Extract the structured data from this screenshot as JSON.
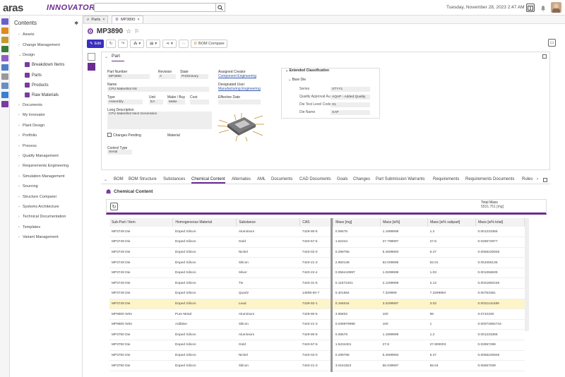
{
  "app": {
    "logo": "aras",
    "logo_suffix": "INNOVATOR",
    "date": "Tuesday, November 28, 2023 2:47 AM",
    "colors": {
      "accent": "#6b2c91",
      "primary": "#3a2ec0",
      "highlight": "#fdf5c8"
    }
  },
  "sidebar": {
    "title": "Contents",
    "items": [
      {
        "label": "Assets"
      },
      {
        "label": "Change Management"
      },
      {
        "label": "Design"
      }
    ],
    "design_children": [
      {
        "label": "Breakdown Items"
      },
      {
        "label": "Parts"
      },
      {
        "label": "Products"
      },
      {
        "label": "Raw Materials"
      }
    ],
    "more_items": [
      {
        "label": "Documents"
      },
      {
        "label": "My Innovator"
      },
      {
        "label": "Plant Design"
      },
      {
        "label": "Portfolio"
      },
      {
        "label": "Process"
      },
      {
        "label": "Quality Management"
      },
      {
        "label": "Requirements Engineering"
      },
      {
        "label": "Simulation Management"
      },
      {
        "label": "Sourcing"
      },
      {
        "label": "Structure Comparer"
      },
      {
        "label": "Systems Architecture"
      },
      {
        "label": "Technical Documentation"
      },
      {
        "label": "Templates"
      },
      {
        "label": "Variant Management"
      }
    ]
  },
  "tabs": [
    {
      "label": "Parts"
    },
    {
      "label": "MP3890"
    }
  ],
  "item": {
    "title": "MP3890"
  },
  "toolbar": {
    "edit": "Edit",
    "bom_compare": "BOM Compare"
  },
  "form": {
    "tab": "Part",
    "part_number_label": "Part Number",
    "part_number": "MP3890",
    "revision_label": "Revision",
    "revision": "A",
    "state_label": "State",
    "state": "Preliminary",
    "name_label": "Name",
    "name": "CPU MakerBot NX",
    "type_label": "Type",
    "type": "Assembly",
    "unit_label": "Unit",
    "unit": "EA",
    "make_buy_label": "Make / Buy",
    "make_buy": "Make",
    "cost_label": "Cost",
    "long_desc_label": "Long Description",
    "long_desc": "CPU MakerBot Next Generation",
    "changes_pending": "Changes Pending",
    "material_label": "Material",
    "control_type_label": "Control Type",
    "control_type": "Serial",
    "assigned_creator_label": "Assigned Creator",
    "assigned_creator": "Component Engineering",
    "designated_user_label": "Designated User",
    "designated_user": "Manufacturing Engineering",
    "effective_date_label": "Effective Date",
    "ext_class_title": "Extended Classification",
    "bare_die": "Bare Die",
    "series_label": "Series",
    "series": "XTYY1",
    "qa_label": "Quality Approval Au...",
    "qa": "AQAP - Added Quality",
    "die_test_label": "Die Test Level Code",
    "die_test": "X1",
    "die_name_label": "Die Name",
    "die_name": "XAP"
  },
  "reltabs": [
    "BOM",
    "BOM Structure",
    "Substances",
    "Chemical Content",
    "Alternates",
    "AML",
    "Documents",
    "CAD Documents",
    "Goals",
    "Changes",
    "Part Submission Warrants",
    "Requirements",
    "Requirements Documents",
    "Rules"
  ],
  "chem": {
    "title": "Chemical Content",
    "total_label": "Total Mass",
    "total": "5531.751 [mg]"
  },
  "table": {
    "headers": [
      "Sub-Part / Item",
      "Homogeneous Material",
      "Substance",
      "CAS",
      "Mass [mg]",
      "Mass [w%]",
      "Mass [w% subpart]",
      "Mass [w% total]"
    ],
    "rows": [
      [
        "MP3749 Die",
        "Doped Silicon",
        "Aluminium",
        "7429-90-5",
        "0.06576",
        "1.1999999",
        "1.2",
        "0.001233366"
      ],
      [
        "MP3749 Die",
        "Doped Silicon",
        "Gold",
        "7440-57-5",
        "1.52344",
        "27.799997",
        "27.8",
        "0.028572977"
      ],
      [
        "MP3749 Die",
        "Doped Silicon",
        "Nickel",
        "7440-02-0",
        "0.299756",
        "5.4699993",
        "5.47",
        "0.0056220926"
      ],
      [
        "MP3749 Die",
        "Doped Silicon",
        "Silicon",
        "7440-21-3",
        "2.850148",
        "52.009995",
        "52.01",
        "0.053456135"
      ],
      [
        "MP3749 Die",
        "Doped Silicon",
        "Silver",
        "7440-22-4",
        "0.056443997",
        "1.0299999",
        "1.03",
        "0.001058639"
      ],
      [
        "MP3749 Die",
        "Doped Silicon",
        "Tin",
        "7440-31-5",
        "0.11672401",
        "2.1299999",
        "2.13",
        "0.0021892246"
      ],
      [
        "MP3749 Die",
        "Doped Silicon",
        "Quartz",
        "14808-60-7",
        "0.401684",
        "7.329999",
        "7.3299994",
        "0.00753381"
      ],
      [
        "MP3749 Die",
        "Doped Silicon",
        "Lead",
        "7439-92-1",
        "0.166044",
        "3.0299997",
        "3.03",
        "0.0031142489"
      ],
      [
        "MP9800 Wire",
        "Pure Metal",
        "Aluminium",
        "7429-90-5",
        "3.95802",
        "100",
        "99",
        "0.0742349"
      ],
      [
        "MP9800 Wire",
        "Additive",
        "Silicon",
        "7440-21-3",
        "0.039979998",
        "100",
        "1",
        "0.00074984744"
      ],
      [
        "MP3750 Die",
        "Doped Silicon",
        "Aluminium",
        "7429-90-5",
        "0.06576",
        "1.1999999",
        "1.2",
        "0.001233366"
      ],
      [
        "MP3750 Die",
        "Doped Silicon",
        "Gold",
        "7440-57-5",
        "1.5234401",
        "27.8",
        "27.800003",
        "0.02857299"
      ],
      [
        "MP3750 Die",
        "Doped Silicon",
        "Nickel",
        "7440-02-0",
        "0.299756",
        "5.4699993",
        "5.47",
        "0.0056220926"
      ],
      [
        "MP3750 Die",
        "Doped Silicon",
        "Silicon",
        "7440-21-3",
        "3.0161922",
        "55.039997",
        "55.04",
        "0.05657039"
      ]
    ],
    "highlight_row": 7
  }
}
